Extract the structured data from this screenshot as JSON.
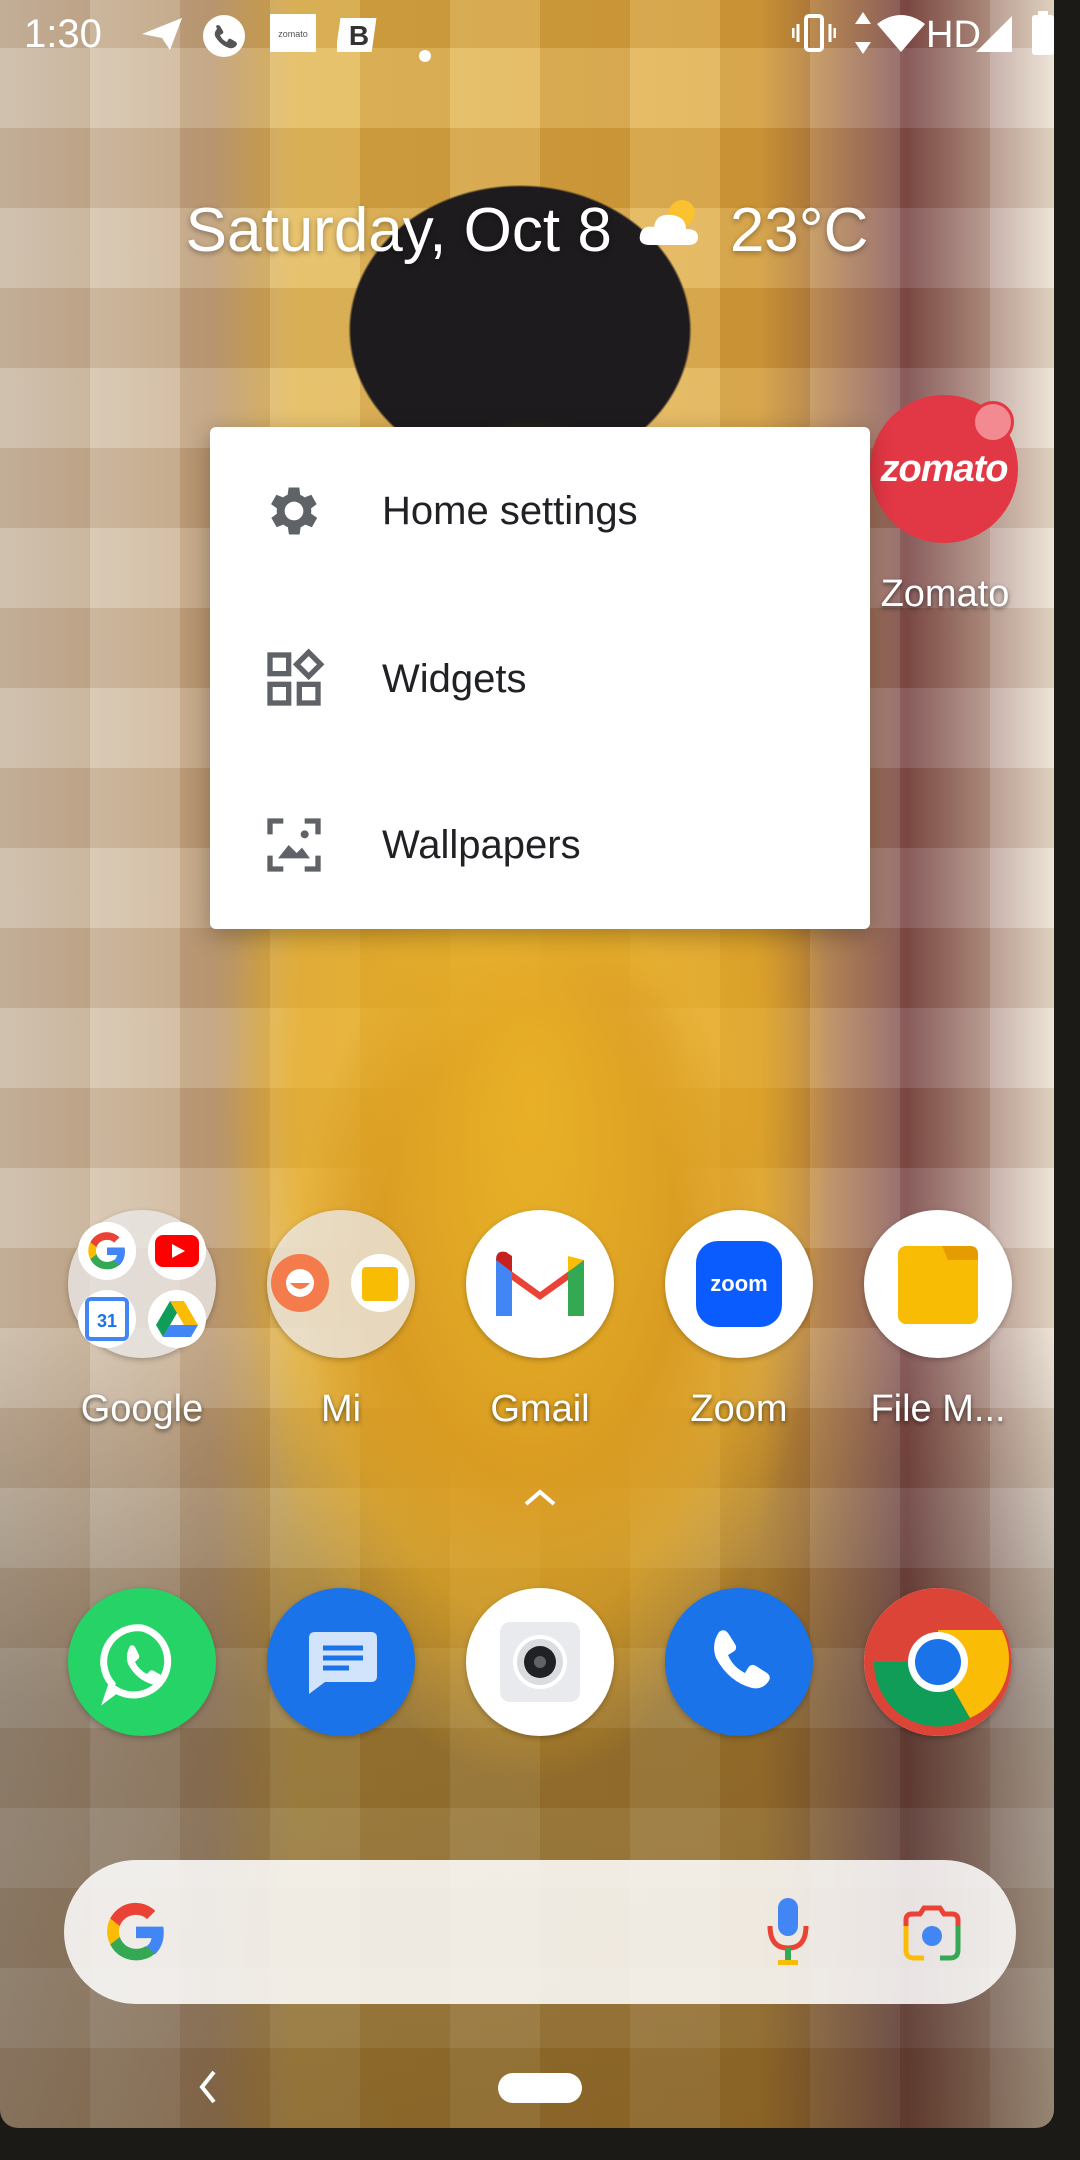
{
  "status_bar": {
    "time": "1:30",
    "network_label": "HD",
    "left_icons": [
      "send-icon",
      "call-icon",
      "zomato-notification-icon",
      "b-app-icon",
      "dot-icon"
    ],
    "right_icons": [
      "vibrate-icon",
      "data-arrows-icon",
      "wifi-icon",
      "signal-icon",
      "battery-icon"
    ]
  },
  "glance": {
    "date": "Saturday, Oct 8",
    "weather_icon": "partly-cloudy-icon",
    "temperature": "23°C"
  },
  "menu": {
    "items": [
      {
        "label": "Home settings",
        "icon": "gear-icon"
      },
      {
        "label": "Widgets",
        "icon": "widgets-icon"
      },
      {
        "label": "Wallpapers",
        "icon": "wallpaper-icon"
      }
    ]
  },
  "home_apps": {
    "zomato": {
      "label": "Zomato",
      "icon_text": "zomato",
      "color": "#e23744"
    },
    "row": [
      {
        "label": "Google"
      },
      {
        "label": "Mi"
      },
      {
        "label": "Gmail"
      },
      {
        "label": "Zoom",
        "icon_text": "zoom"
      },
      {
        "label": "File M..."
      }
    ],
    "google_folder_calendar": "31"
  },
  "dock": {
    "apps": [
      "whatsapp-icon",
      "messages-icon",
      "camera-icon",
      "phone-icon",
      "chrome-icon"
    ]
  },
  "colors": {
    "whatsapp": "#25d366",
    "messages": "#1a73e8",
    "phone": "#1a73e8",
    "zoom": "#0b5cff",
    "file_manager": "#f9bc05"
  }
}
